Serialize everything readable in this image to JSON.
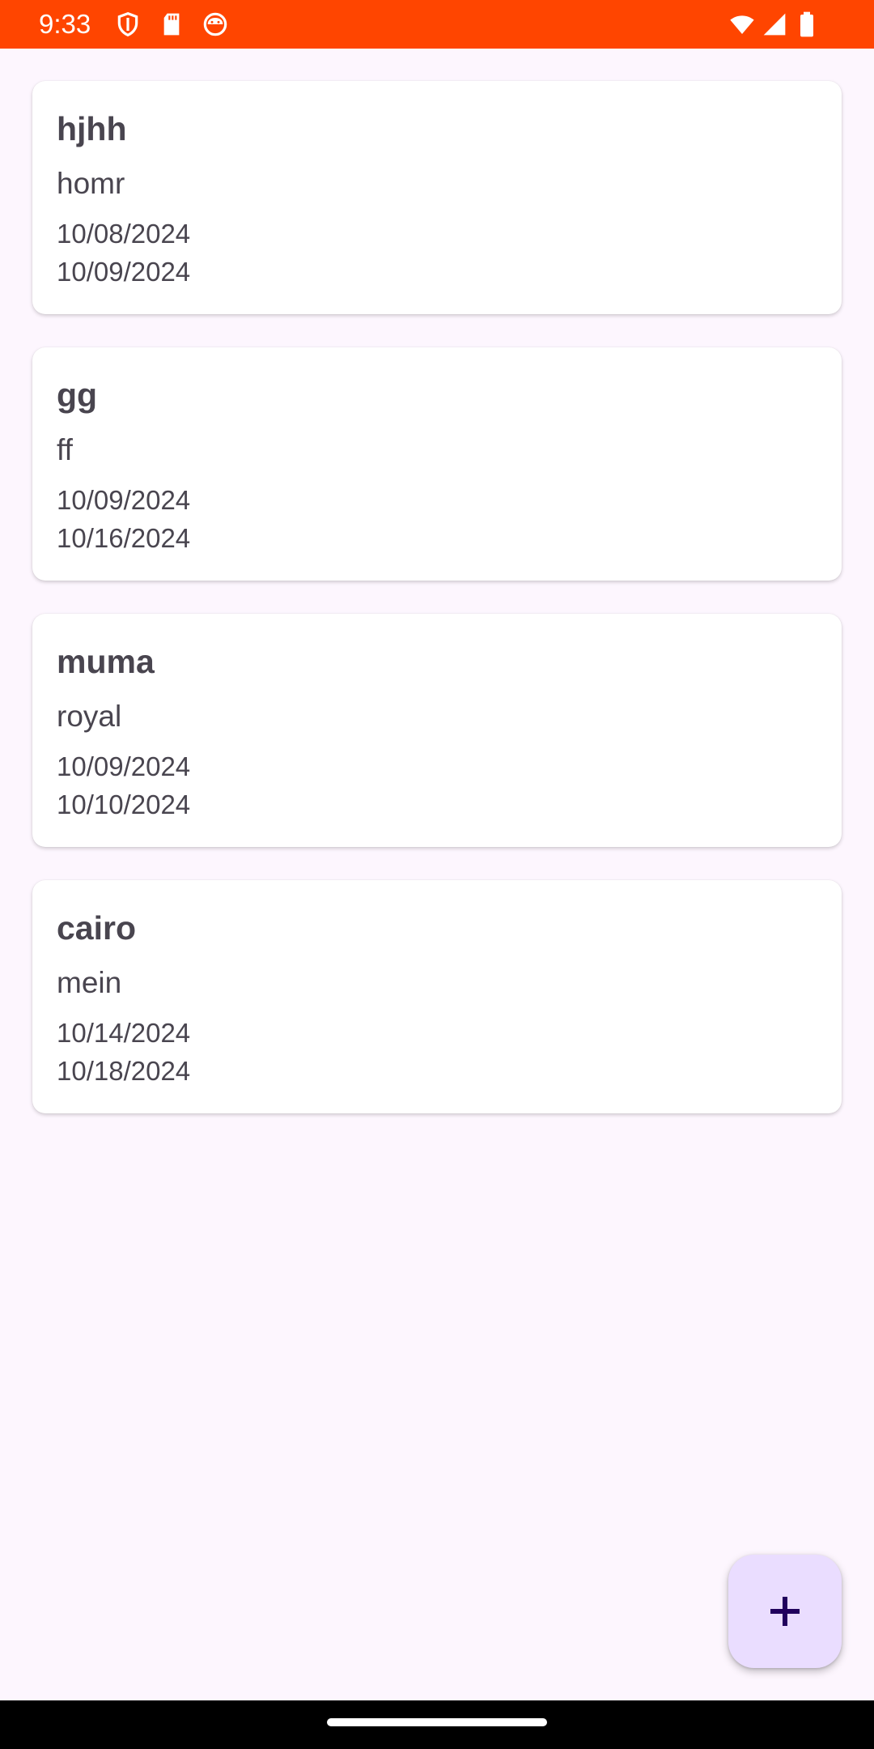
{
  "status_bar": {
    "time": "9:33",
    "background": "#ff4500",
    "left_icons": [
      "shield-icon",
      "sd-card-icon",
      "android-face-icon"
    ],
    "right_icons": [
      "wifi-icon",
      "signal-icon",
      "battery-icon"
    ]
  },
  "cards": [
    {
      "title": "hjhh",
      "subtitle": "homr",
      "start_date": "10/08/2024",
      "end_date": "10/09/2024"
    },
    {
      "title": "gg",
      "subtitle": "ff",
      "start_date": "10/09/2024",
      "end_date": "10/16/2024"
    },
    {
      "title": "muma",
      "subtitle": "royal",
      "start_date": "10/09/2024",
      "end_date": "10/10/2024"
    },
    {
      "title": "cairo",
      "subtitle": "mein",
      "start_date": "10/14/2024",
      "end_date": "10/18/2024"
    }
  ],
  "fab": {
    "icon": "plus-icon",
    "background": "#eaddff",
    "icon_color": "#21005d"
  },
  "colors": {
    "background": "#fdf6fe",
    "card": "#ffffff",
    "text": "#49454f"
  }
}
